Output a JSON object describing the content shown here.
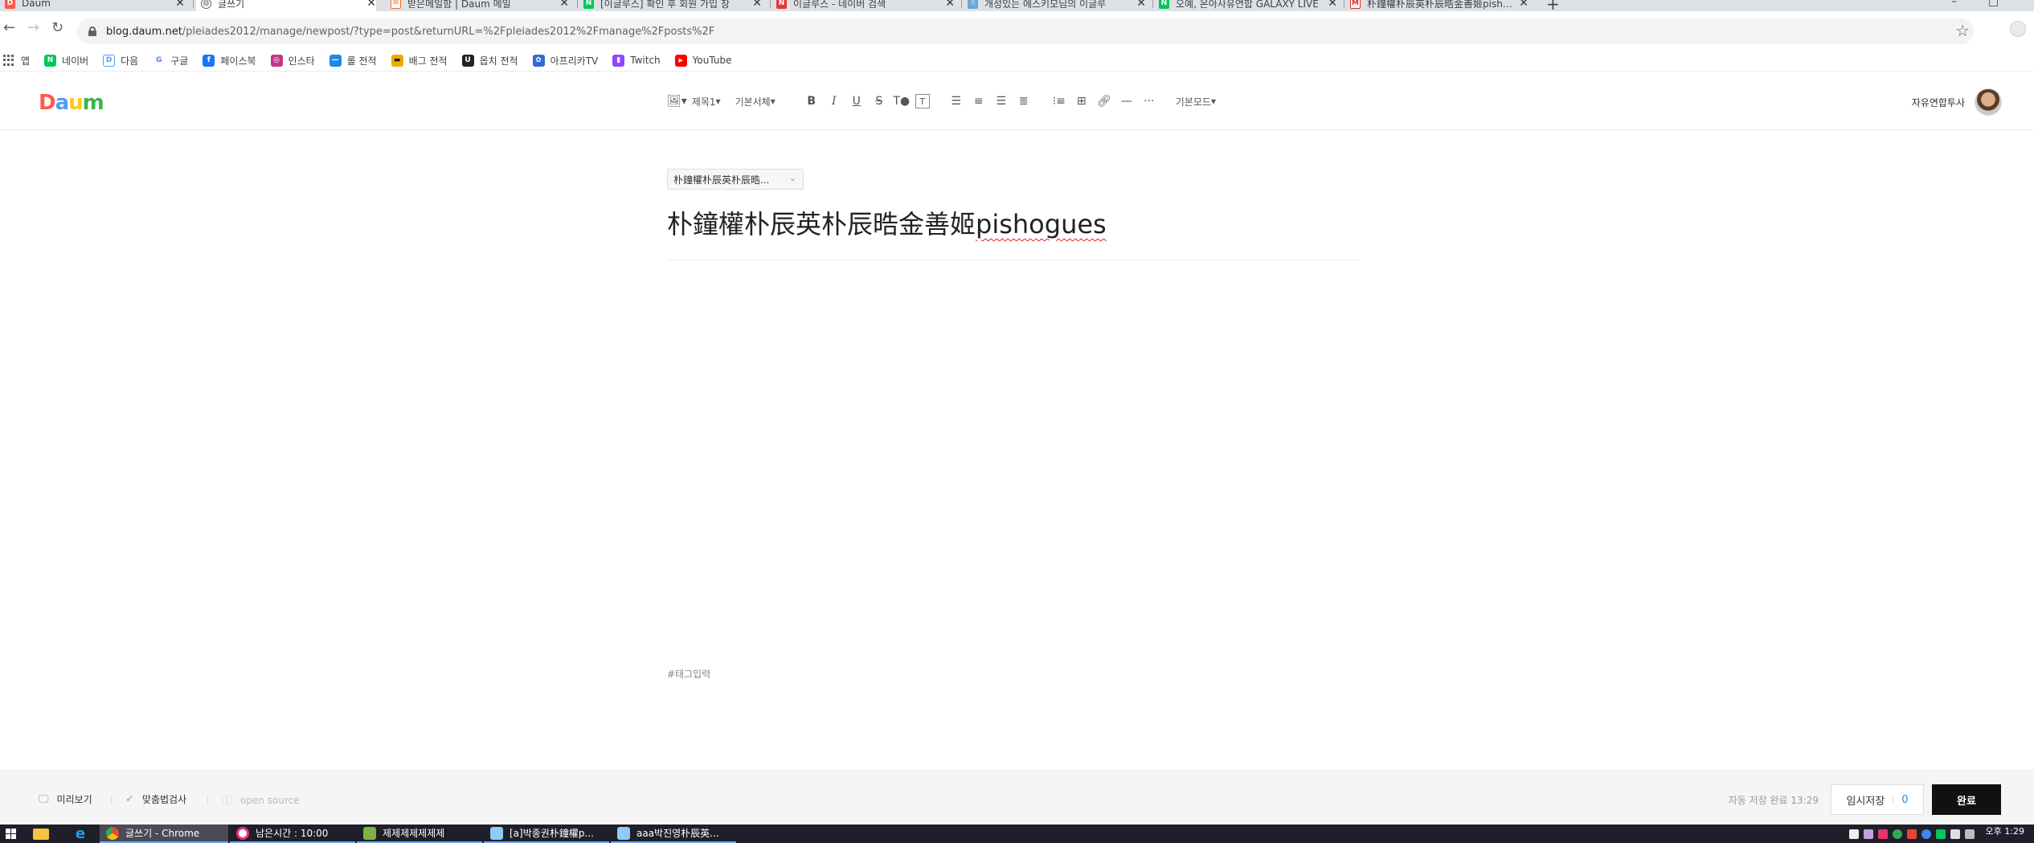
{
  "browser": {
    "tabs": [
      {
        "title": "Daum",
        "icon": "daum-icon",
        "color": "#ff5a4a",
        "active": false
      },
      {
        "title": "글쓰기",
        "icon": "globe-icon",
        "color": "#5f6368",
        "active": true
      },
      {
        "title": "받은메일함 | Daum 메일",
        "icon": "mail-icon",
        "color": "#f26d21",
        "active": false
      },
      {
        "title": "[이글루스] 확인 후 회원 가입 창",
        "icon": "naver-icon",
        "color": "#03c75a",
        "active": false
      },
      {
        "title": "이글루스 - 네이버 검색",
        "icon": "naver-icon",
        "color": "#e53935",
        "active": false
      },
      {
        "title": "개성있는 에스키모님의 이글루",
        "icon": "eskimo-icon",
        "color": "#6aa7d8",
        "active": false
      },
      {
        "title": "오예, 온아사유연합 GALAXY LIVE",
        "icon": "naver-icon",
        "color": "#03c75a",
        "active": false
      },
      {
        "title": "朴鐘權朴辰英朴辰晧金善姬pishogues",
        "icon": "gmail-icon",
        "color": "#d93025",
        "active": false
      }
    ],
    "new_tab_label": "+",
    "window_controls": {
      "minimize": "–",
      "maximize": "□"
    },
    "url": {
      "host": "blog.daum.net",
      "path": "/pleiades2012/manage/newpost/?type=post&returnURL=%2Fpleiades2012%2Fmanage%2Fposts%2F"
    }
  },
  "bookmarks": [
    {
      "label": "앱",
      "icon": "apps-grid-icon",
      "color": "#5f6368"
    },
    {
      "label": "네이버",
      "icon": "naver-icon",
      "color": "#03c75a",
      "glyph": "N"
    },
    {
      "label": "다음",
      "icon": "daum-icon",
      "color": "#4f9cf9",
      "glyph": "D"
    },
    {
      "label": "구글",
      "icon": "google-icon",
      "color": "#4285f4",
      "glyph": "G"
    },
    {
      "label": "페이스북",
      "icon": "facebook-icon",
      "color": "#1877f2",
      "glyph": "f"
    },
    {
      "label": "인스타",
      "icon": "instagram-icon",
      "color": "#c13584",
      "glyph": "◎"
    },
    {
      "label": "롤 전적",
      "icon": "lol-icon",
      "color": "#1e88e5",
      "glyph": "—"
    },
    {
      "label": "배그 전적",
      "icon": "pubg-icon",
      "color": "#f2a900",
      "glyph": "▬"
    },
    {
      "label": "옵치 전적",
      "icon": "overwatch-icon",
      "color": "#222222",
      "glyph": "U"
    },
    {
      "label": "아프리카TV",
      "icon": "afreecatv-icon",
      "color": "#2f6ad9",
      "glyph": "✿"
    },
    {
      "label": "Twitch",
      "icon": "twitch-icon",
      "color": "#9146ff",
      "glyph": "▮"
    },
    {
      "label": "YouTube",
      "icon": "youtube-icon",
      "color": "#ff0000",
      "glyph": "▶"
    }
  ],
  "editor": {
    "toolbar": {
      "heading_select": "제목1",
      "font_select": "기본서체",
      "mode_select": "기본모드"
    },
    "user_name": "자유연합투사",
    "category": "朴鐘權朴辰英朴辰晧...",
    "title_prefix": "朴鐘權朴辰英朴辰晧金善姬",
    "title_suffix": "pishogues",
    "tag_placeholder": "#태그입력"
  },
  "footer": {
    "preview": "미리보기",
    "spellcheck": "맞춤법검사",
    "open_source": "open source",
    "autosave_status": "자동 저장 완료 13:29",
    "draft_label": "임시저장",
    "draft_count": "0",
    "done_label": "완료"
  },
  "taskbar": {
    "tasks": [
      {
        "label": "글쓰기 - Chrome",
        "color": "#4285f4",
        "active": true
      },
      {
        "label": "남은시간 : 10:00",
        "color": "#e8336e",
        "active": false
      },
      {
        "label": "제제제제제제제",
        "color": "#7cb342",
        "active": false
      },
      {
        "label": "[a]박종권朴鐘權p...",
        "color": "#90caf9",
        "active": false
      },
      {
        "label": "aaa박진영朴辰英...",
        "color": "#90caf9",
        "active": false
      }
    ],
    "clock_ampm": "오후 1:29"
  },
  "colors": {
    "daum_d": "#ff5a4a",
    "daum_a": "#4f9cf9",
    "daum_u": "#ffc61a",
    "daum_m": "#3cb44b",
    "accent_blue": "#2a8bd6"
  }
}
